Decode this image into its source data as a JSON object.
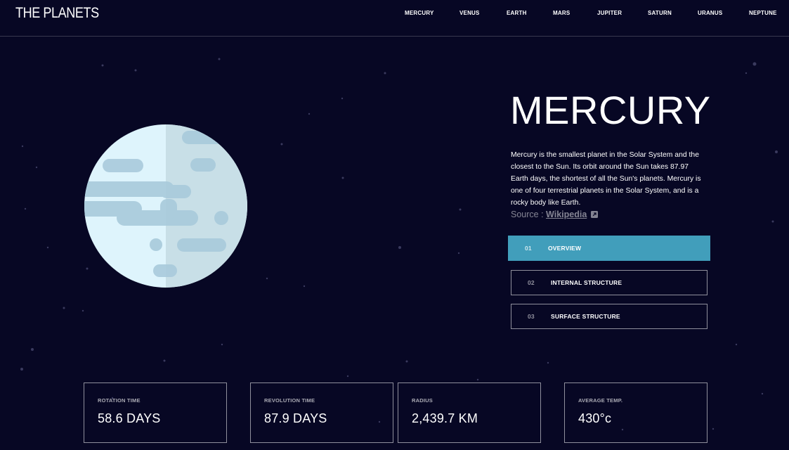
{
  "header": {
    "logo": "THE PLANETS",
    "nav": [
      "MERCURY",
      "VENUS",
      "EARTH",
      "MARS",
      "JUPITER",
      "SATURN",
      "URANUS",
      "NEPTUNE"
    ]
  },
  "planet": {
    "name": "MERCURY",
    "description": "Mercury is the smallest planet in the Solar System and the closest to the Sun. Its orbit around the Sun takes 87.97 Earth days, the shortest of all the Sun's planets. Mercury is one of four terrestrial planets in the Solar System, and is a rocky body like Earth.",
    "source_prefix": "Source : ",
    "source_link": "Wikipedia",
    "source_icon": "external-link-icon"
  },
  "tabs": [
    {
      "num": "01",
      "label": "OVERVIEW",
      "active": true
    },
    {
      "num": "02",
      "label": "INTERNAL STRUCTURE",
      "active": false
    },
    {
      "num": "03",
      "label": "SURFACE STRUCTURE",
      "active": false
    }
  ],
  "stats": [
    {
      "label": "ROTATION TIME",
      "value": "58.6 DAYS"
    },
    {
      "label": "REVOLUTION TIME",
      "value": "87.9 DAYS"
    },
    {
      "label": "RADIUS",
      "value": "2,439.7 KM"
    },
    {
      "label": "AVERAGE TEMP.",
      "value": "430°c"
    }
  ],
  "colors": {
    "background": "#070724",
    "accent": "#419EBB",
    "planet_light": "#DEF4FC",
    "planet_shade": "#C8DFE7",
    "crater": "#A8CADB"
  }
}
